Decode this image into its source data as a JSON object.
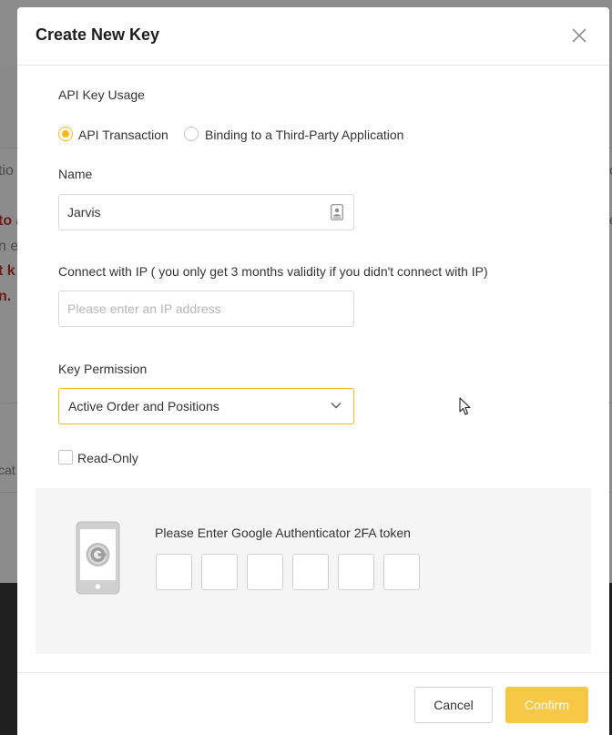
{
  "background": {
    "fragments": {
      "tio": "tio",
      "to_a": "to a",
      "n_e": "n e",
      "t_k": "t k",
      "n_dot": "n.",
      "cat": "cat",
      "right_c": "c",
      "right_e": "e"
    }
  },
  "modal": {
    "title": "Create New Key",
    "usage": {
      "label": "API Key Usage",
      "options": [
        {
          "label": "API Transaction",
          "checked": true
        },
        {
          "label": "Binding to a Third-Party Application",
          "checked": false
        }
      ]
    },
    "name": {
      "label": "Name",
      "value": "Jarvis"
    },
    "ip": {
      "label": "Connect with IP ( you only get 3 months validity if you didn't connect with IP)",
      "placeholder": "Please enter an IP address",
      "value": ""
    },
    "permission": {
      "label": "Key Permission",
      "selected": "Active Order and Positions"
    },
    "read_only": {
      "label": "Read-Only",
      "checked": false
    },
    "twofa": {
      "title": "Please Enter Google Authenticator 2FA token",
      "digits": [
        "",
        "",
        "",
        "",
        "",
        ""
      ]
    },
    "buttons": {
      "cancel": "Cancel",
      "confirm": "Confirm"
    }
  },
  "colors": {
    "accent": "#f5b91e",
    "confirm_bg": "#f7c845",
    "panel_bg": "#f5f5f5",
    "overlay_bg": "#8c8c8c"
  },
  "icons": [
    "close-icon",
    "contact-card-icon",
    "chevron-down-icon",
    "authenticator-phone-icon",
    "mouse-cursor-icon"
  ]
}
